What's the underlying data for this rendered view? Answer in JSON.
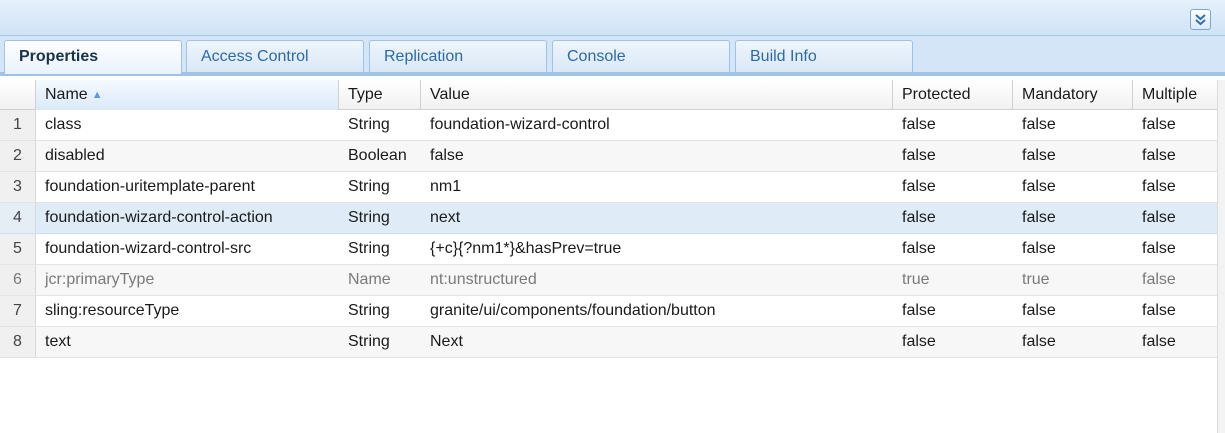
{
  "tabs": [
    {
      "label": "Properties",
      "active": true
    },
    {
      "label": "Access Control",
      "active": false
    },
    {
      "label": "Replication",
      "active": false
    },
    {
      "label": "Console",
      "active": false
    },
    {
      "label": "Build Info",
      "active": false
    }
  ],
  "columns": {
    "name": "Name",
    "type": "Type",
    "value": "Value",
    "protected": "Protected",
    "mandatory": "Mandatory",
    "multiple": "Multiple"
  },
  "sort": {
    "column": "name",
    "direction": "ascending"
  },
  "rows": [
    {
      "num": "1",
      "name": "class",
      "type": "String",
      "value": "foundation-wizard-control",
      "protected": "false",
      "mandatory": "false",
      "multiple": "false"
    },
    {
      "num": "2",
      "name": "disabled",
      "type": "Boolean",
      "value": "false",
      "protected": "false",
      "mandatory": "false",
      "multiple": "false"
    },
    {
      "num": "3",
      "name": "foundation-uritemplate-parent",
      "type": "String",
      "value": "nm1",
      "protected": "false",
      "mandatory": "false",
      "multiple": "false"
    },
    {
      "num": "4",
      "name": "foundation-wizard-control-action",
      "type": "String",
      "value": "next",
      "protected": "false",
      "mandatory": "false",
      "multiple": "false",
      "selected": true
    },
    {
      "num": "5",
      "name": "foundation-wizard-control-src",
      "type": "String",
      "value": "{+c}{?nm1*}&hasPrev=true",
      "protected": "false",
      "mandatory": "false",
      "multiple": "false"
    },
    {
      "num": "6",
      "name": "jcr:primaryType",
      "type": "Name",
      "value": "nt:unstructured",
      "protected": "true",
      "mandatory": "true",
      "multiple": "false",
      "muted": true
    },
    {
      "num": "7",
      "name": "sling:resourceType",
      "type": "String",
      "value": "granite/ui/components/foundation/button",
      "protected": "false",
      "mandatory": "false",
      "multiple": "false"
    },
    {
      "num": "8",
      "name": "text",
      "type": "String",
      "value": "Next",
      "protected": "false",
      "mandatory": "false",
      "multiple": "false"
    }
  ],
  "colors": {
    "accent": "#5b9bd5",
    "selected_row": "#dfecf8",
    "tab_text": "#2a6aa8"
  }
}
